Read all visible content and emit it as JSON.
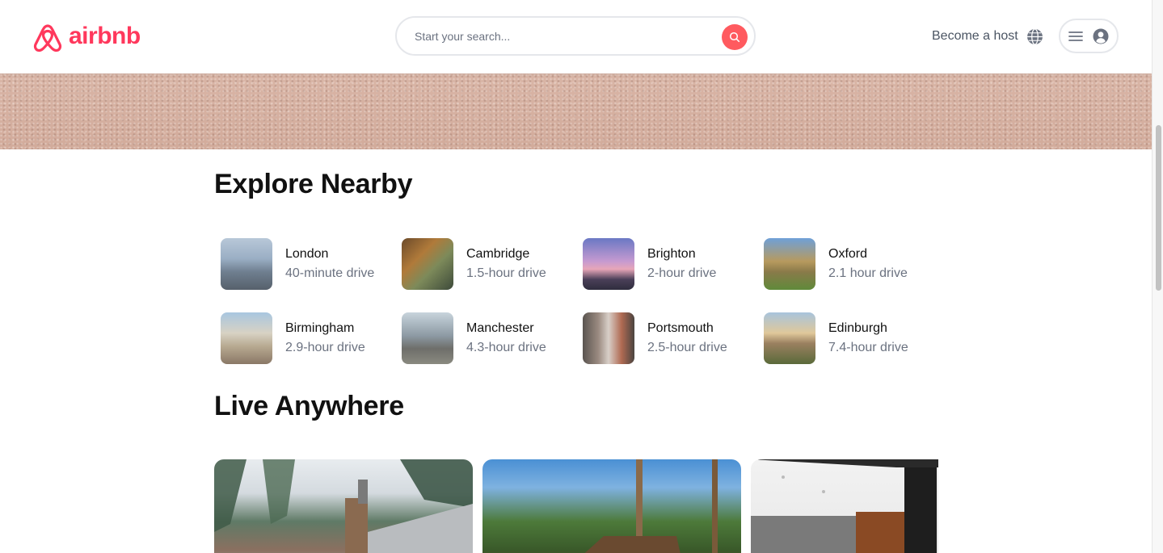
{
  "brand": {
    "name": "airbnb",
    "color": "#FF385C"
  },
  "search": {
    "placeholder": "Start your search...",
    "icon": "search-icon",
    "button_color": "#FF5A5F"
  },
  "nav": {
    "become_host": "Become a host",
    "globe_icon": "globe-icon",
    "menu_icon": "hamburger-icon",
    "user_icon": "user-circle-icon"
  },
  "explore": {
    "title": "Explore Nearby",
    "places": [
      {
        "name": "London",
        "distance": "40-minute drive"
      },
      {
        "name": "Cambridge",
        "distance": "1.5-hour drive"
      },
      {
        "name": "Brighton",
        "distance": "2-hour drive"
      },
      {
        "name": "Oxford",
        "distance": "2.1 hour drive"
      },
      {
        "name": "Birmingham",
        "distance": "2.9-hour drive"
      },
      {
        "name": "Manchester",
        "distance": "4.3-hour drive"
      },
      {
        "name": "Portsmouth",
        "distance": "2.5-hour drive"
      },
      {
        "name": "Edinburgh",
        "distance": "7.4-hour drive"
      }
    ]
  },
  "live": {
    "title": "Live Anywhere"
  }
}
